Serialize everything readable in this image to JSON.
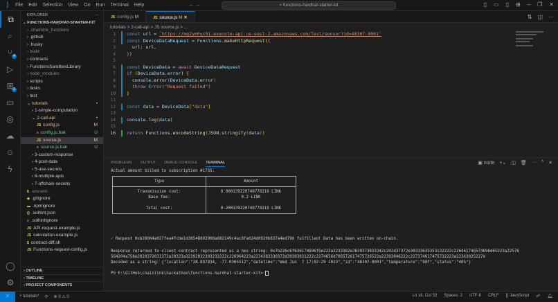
{
  "titlebar": {
    "menu": [
      "File",
      "Edit",
      "Selection",
      "View",
      "Go",
      "Run",
      "Terminal",
      "Help"
    ],
    "search": "functions-hardhat-starter-kit",
    "nav": "← →"
  },
  "activity": {
    "scm_badge": "4",
    "ext_badge": "1"
  },
  "sidebar": {
    "title": "EXPLORER",
    "more": "···",
    "root": "FUNCTIONS-HARDHAT-STARTER-KIT",
    "items": [
      {
        "label": ".chainlink_functions",
        "indent": 1,
        "arrow": ">",
        "dim": true
      },
      {
        "label": ".github",
        "indent": 1,
        "arrow": ">"
      },
      {
        "label": ".husky",
        "indent": 1,
        "arrow": ">"
      },
      {
        "label": "build",
        "indent": 1,
        "arrow": ">",
        "dim": true
      },
      {
        "label": "contracts",
        "indent": 1,
        "arrow": ">"
      },
      {
        "label": "FunctionsSandboxLibrary",
        "indent": 1,
        "arrow": ">"
      },
      {
        "label": "node_modules",
        "indent": 1,
        "arrow": ">",
        "dim": true
      },
      {
        "label": "scripts",
        "indent": 1,
        "arrow": ">"
      },
      {
        "label": "tasks",
        "indent": 1,
        "arrow": ">"
      },
      {
        "label": "test",
        "indent": 1,
        "arrow": ">"
      },
      {
        "label": "tutorials",
        "indent": 1,
        "arrow": "v",
        "status": "•",
        "cls": "mod"
      },
      {
        "label": "1-simple-computation",
        "indent": 2,
        "arrow": ">"
      },
      {
        "label": "2-call-api",
        "indent": 2,
        "arrow": "v",
        "status": "•",
        "cls": "mod"
      },
      {
        "label": "config.js",
        "indent": 3,
        "icon": "JS",
        "status": "M",
        "cls": "mod"
      },
      {
        "label": "config.js.bak",
        "indent": 3,
        "icon": "≡",
        "status": "U",
        "cls": "unt"
      },
      {
        "label": "source.js",
        "indent": 3,
        "icon": "JS",
        "status": "M",
        "cls": "mod",
        "sel": true
      },
      {
        "label": "source.js.bak",
        "indent": 3,
        "icon": "≡",
        "status": "U",
        "cls": "unt"
      },
      {
        "label": "3-custom-response",
        "indent": 2,
        "arrow": ">"
      },
      {
        "label": "4-post-data",
        "indent": 2,
        "arrow": ">"
      },
      {
        "label": "5-use-secrets",
        "indent": 2,
        "arrow": ">"
      },
      {
        "label": "6-multiple-apis",
        "indent": 2,
        "arrow": ">"
      },
      {
        "label": "7-offchain-secrets",
        "indent": 2,
        "arrow": ">"
      },
      {
        "label": ".env.enc",
        "indent": 1,
        "icon": "$",
        "dim": true
      },
      {
        "label": ".gitignore",
        "indent": 1,
        "icon": "◆"
      },
      {
        "label": ".npmignore",
        "indent": 1,
        "icon": "▬"
      },
      {
        "label": ".solhint.json",
        "indent": 1,
        "icon": "{}"
      },
      {
        "label": ".solhintignore",
        "indent": 1,
        "icon": "≡"
      },
      {
        "label": "API-request-example.js",
        "indent": 1,
        "icon": "JS"
      },
      {
        "label": "calculation-example.js",
        "indent": 1,
        "icon": "JS"
      },
      {
        "label": "contract-diff.sh",
        "indent": 1,
        "icon": "$"
      },
      {
        "label": "Functions-request-config.js",
        "indent": 1,
        "icon": "JS"
      }
    ],
    "sections": [
      "OUTLINE",
      "TIMELINE",
      "PROJECT COMPONENTS"
    ]
  },
  "tabs": [
    {
      "label": "config.js",
      "status": "M"
    },
    {
      "label": "source.js",
      "status": "M",
      "close": "✕"
    }
  ],
  "breadcrumb": "tutorials > 2-call-api > JS source.js > ...",
  "code_lines": [
    "1",
    "2",
    "3",
    "4",
    "5",
    "6",
    "7",
    "8",
    "9",
    "10",
    "11",
    "12",
    "13",
    "14",
    "15",
    "16"
  ],
  "code": {
    "url": "`https://mg2ym0yc91.execute-api.us-east-2.amazonaws.com/Test/sensor?id=48307-0001`",
    "err": "\"Request failed\"",
    "key": "\"data\""
  },
  "panel": {
    "tabs": [
      "PROBLEMS",
      "OUTPUT",
      "DEBUG CONSOLE",
      "TERMINAL"
    ],
    "shell": "node"
  },
  "terminal": {
    "billed": "Actual amount billed to subscription #1735:",
    "headers": [
      "Type",
      "Amount"
    ],
    "tx_label": "Transmission cost:",
    "tx_value": "0.000139220749778219 LINK",
    "base_label": "Base fee:",
    "base_value": "0.2 LINK",
    "total_label": "Total cost:",
    "total_value": "0.200139220749778219 LINK",
    "fulfilled": "Request 0xb28964a027fea4fcbe1d36548892908a882149c4ac8fa024d0920b837a4ed796 fulfilled! Data has been written on-chain.",
    "response1": "Response returned to client contract represented as a hex string: 0x7b226c6f636174696f6e223a2233382e3839373833342c202d37372e30333635353132222c226461746574696d65223a22576",
    "response2": "564204a756e2020372031373a30323a32392032303233222c226964223a2234383330372d30303031222c2274656d706572617475726522a22393046222c227374617475732223a22343025227d",
    "decoded": "Decoded as a string: {\"location\":\"38.897834, -77.0365512\",\"datetime\":\"Wed Jun  7 17:02:29 2023\",\"id\":\"48307-0001\",\"temperature\":\"90F\",\"status\":\"40%\"}",
    "prompt": "PS E:\\GitHub\\chainlink\\hackathon\\functions-hardhat-starter-kit> "
  },
  "status": {
    "branch": "tutorials*",
    "errors": "0",
    "warnings": "0",
    "position": "Ln 16, Col 52",
    "spaces": "Spaces: 2",
    "encoding": "UTF-8",
    "eol": "CRLF",
    "language": "{} JavaScript"
  }
}
